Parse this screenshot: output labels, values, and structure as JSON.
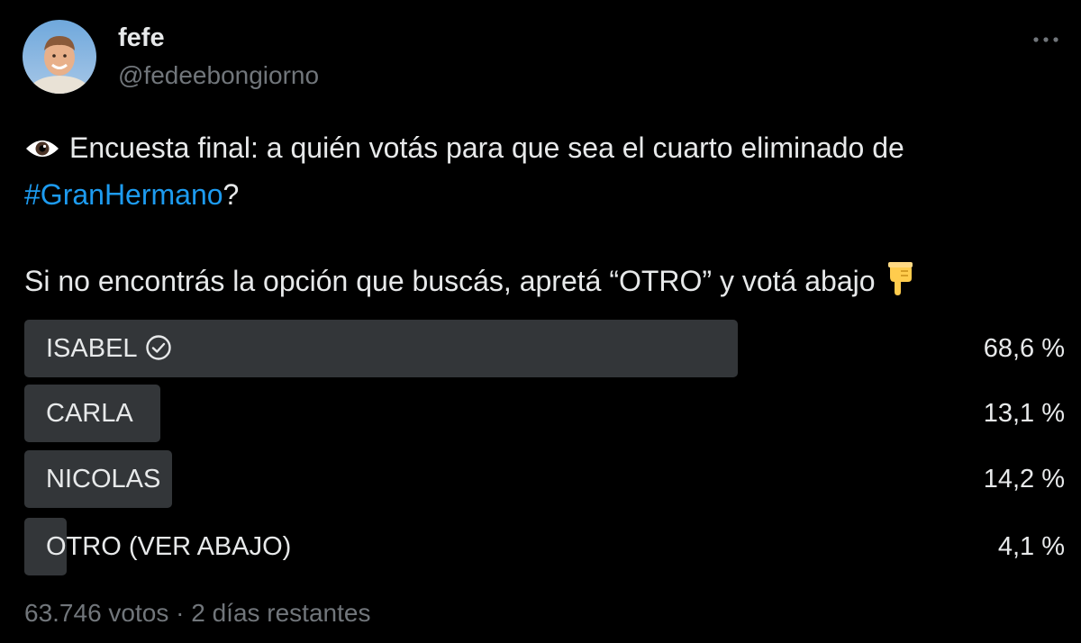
{
  "author": {
    "display_name": "fefe",
    "handle": "@fedeebongiorno",
    "avatar_icon": "avatar-photo"
  },
  "more_icon": "more-dots-icon",
  "tweet": {
    "line1_text": "Encuesta final: a quién votás para que sea el cuarto eliminado de",
    "hashtag": "#GranHermano",
    "line2_suffix": "?",
    "line3_text": "Si no encontrás la opción que buscás, apretá “OTRO” y votá abajo",
    "leading_icon": "eye-icon",
    "trailing_icon": "pointing-down-hand-icon"
  },
  "poll": {
    "options": [
      {
        "label": "ISABEL",
        "percent": "68,6 %",
        "fraction": 0.686,
        "winner": true
      },
      {
        "label": "CARLA",
        "percent": "13,1 %",
        "fraction": 0.131,
        "winner": false
      },
      {
        "label": "NICOLAS",
        "percent": "14,2 %",
        "fraction": 0.142,
        "winner": false
      },
      {
        "label": "OTRO (VER ABAJO)",
        "percent": "4,1 %",
        "fraction": 0.041,
        "winner": false
      }
    ],
    "votes": "63.746 votos",
    "separator": "·",
    "time_left": "2 días restantes"
  },
  "colors": {
    "background": "#000000",
    "text": "#e7e9ea",
    "secondary_text": "#71767b",
    "link": "#1d9bf0",
    "poll_bar": "#333639"
  }
}
